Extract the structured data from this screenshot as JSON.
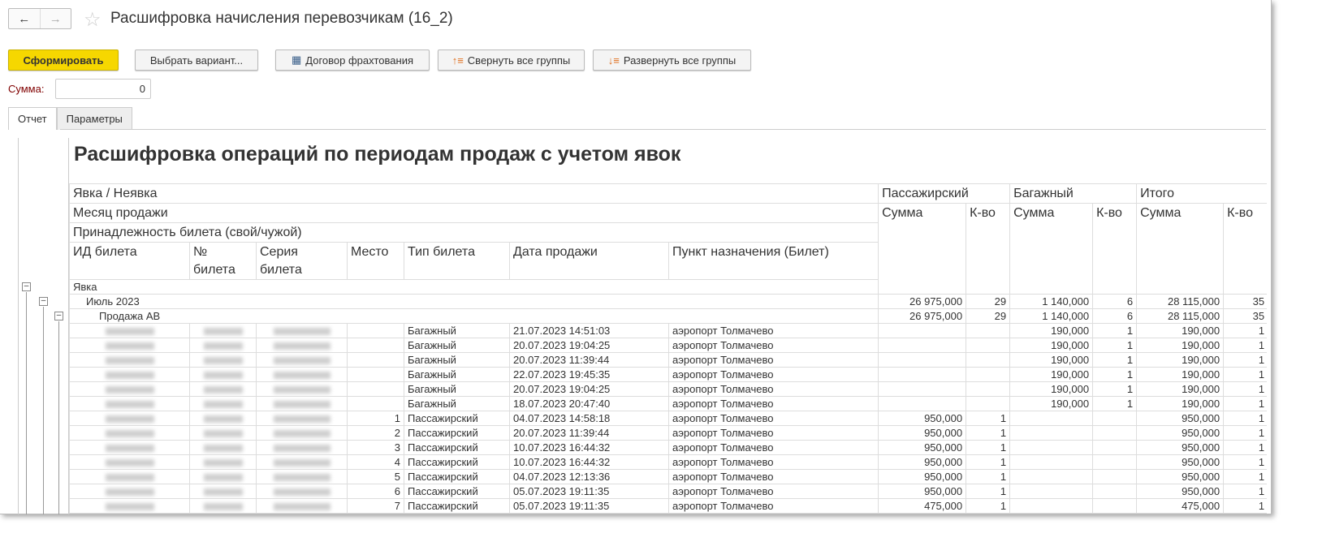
{
  "window": {
    "title": "Расшифровка начисления перевозчикам (16_2)"
  },
  "toolbar": {
    "generate": "Сформировать",
    "choose_variant": "Выбрать вариант...",
    "charter": "Договор фрахтования",
    "collapse": "Свернуть все группы",
    "expand": "Развернуть все группы"
  },
  "sum_field": {
    "label": "Сумма:",
    "value": "0"
  },
  "tabs": [
    "Отчет",
    "Параметры"
  ],
  "report": {
    "title": "Расшифровка операций по периодам продаж с учетом явок",
    "headers": {
      "group1": "Явка / Неявка",
      "group2": "Месяц продажи",
      "group3": "Принадлежность билета (свой/чужой)",
      "cols": [
        "ИД билета",
        "№ билета",
        "Серия билета",
        "Место",
        "Тип билета",
        "Дата продажи",
        "Пункт назначения (Билет)"
      ],
      "passenger": "Пассажирский",
      "baggage": "Багажный",
      "total": "Итого",
      "sum": "Сумма",
      "qty": "К-во"
    },
    "groups": [
      {
        "label": "Явка",
        "p_sum": "26 975,000",
        "p_qty": "29",
        "b_sum": "1 140,000",
        "b_qty": "6",
        "t_sum": "28 115,000",
        "t_qty": "35"
      },
      {
        "label": "Июль 2023",
        "p_sum": "26 975,000",
        "p_qty": "29",
        "b_sum": "1 140,000",
        "b_qty": "6",
        "t_sum": "28 115,000",
        "t_qty": "35"
      },
      {
        "label": "Продажа АВ",
        "p_sum": "26 975,000",
        "p_qty": "29",
        "b_sum": "1 140,000",
        "b_qty": "6",
        "t_sum": "28 115,000",
        "t_qty": "35"
      }
    ],
    "rows": [
      {
        "seat": "",
        "type": "Багажный",
        "date": "21.07.2023 14:51:03",
        "dest": "аэропорт Толмачево",
        "p_sum": "",
        "p_qty": "",
        "b_sum": "190,000",
        "b_qty": "1",
        "t_sum": "190,000",
        "t_qty": "1"
      },
      {
        "seat": "",
        "type": "Багажный",
        "date": "20.07.2023 19:04:25",
        "dest": "аэропорт Толмачево",
        "p_sum": "",
        "p_qty": "",
        "b_sum": "190,000",
        "b_qty": "1",
        "t_sum": "190,000",
        "t_qty": "1"
      },
      {
        "seat": "",
        "type": "Багажный",
        "date": "20.07.2023 11:39:44",
        "dest": "аэропорт Толмачево",
        "p_sum": "",
        "p_qty": "",
        "b_sum": "190,000",
        "b_qty": "1",
        "t_sum": "190,000",
        "t_qty": "1"
      },
      {
        "seat": "",
        "type": "Багажный",
        "date": "22.07.2023 19:45:35",
        "dest": "аэропорт Толмачево",
        "p_sum": "",
        "p_qty": "",
        "b_sum": "190,000",
        "b_qty": "1",
        "t_sum": "190,000",
        "t_qty": "1"
      },
      {
        "seat": "",
        "type": "Багажный",
        "date": "20.07.2023 19:04:25",
        "dest": "аэропорт Толмачево",
        "p_sum": "",
        "p_qty": "",
        "b_sum": "190,000",
        "b_qty": "1",
        "t_sum": "190,000",
        "t_qty": "1"
      },
      {
        "seat": "",
        "type": "Багажный",
        "date": "18.07.2023 20:47:40",
        "dest": "аэропорт Толмачево",
        "p_sum": "",
        "p_qty": "",
        "b_sum": "190,000",
        "b_qty": "1",
        "t_sum": "190,000",
        "t_qty": "1"
      },
      {
        "seat": "1",
        "type": "Пассажирский",
        "date": "04.07.2023 14:58:18",
        "dest": "аэропорт Толмачево",
        "p_sum": "950,000",
        "p_qty": "1",
        "b_sum": "",
        "b_qty": "",
        "t_sum": "950,000",
        "t_qty": "1"
      },
      {
        "seat": "2",
        "type": "Пассажирский",
        "date": "20.07.2023 11:39:44",
        "dest": "аэропорт Толмачево",
        "p_sum": "950,000",
        "p_qty": "1",
        "b_sum": "",
        "b_qty": "",
        "t_sum": "950,000",
        "t_qty": "1"
      },
      {
        "seat": "3",
        "type": "Пассажирский",
        "date": "10.07.2023 16:44:32",
        "dest": "аэропорт Толмачево",
        "p_sum": "950,000",
        "p_qty": "1",
        "b_sum": "",
        "b_qty": "",
        "t_sum": "950,000",
        "t_qty": "1"
      },
      {
        "seat": "4",
        "type": "Пассажирский",
        "date": "10.07.2023 16:44:32",
        "dest": "аэропорт Толмачево",
        "p_sum": "950,000",
        "p_qty": "1",
        "b_sum": "",
        "b_qty": "",
        "t_sum": "950,000",
        "t_qty": "1"
      },
      {
        "seat": "5",
        "type": "Пассажирский",
        "date": "04.07.2023 12:13:36",
        "dest": "аэропорт Толмачево",
        "p_sum": "950,000",
        "p_qty": "1",
        "b_sum": "",
        "b_qty": "",
        "t_sum": "950,000",
        "t_qty": "1"
      },
      {
        "seat": "6",
        "type": "Пассажирский",
        "date": "05.07.2023 19:11:35",
        "dest": "аэропорт Толмачево",
        "p_sum": "950,000",
        "p_qty": "1",
        "b_sum": "",
        "b_qty": "",
        "t_sum": "950,000",
        "t_qty": "1"
      },
      {
        "seat": "7",
        "type": "Пассажирский",
        "date": "05.07.2023 19:11:35",
        "dest": "аэропорт Толмачево",
        "p_sum": "475,000",
        "p_qty": "1",
        "b_sum": "",
        "b_qty": "",
        "t_sum": "475,000",
        "t_qty": "1"
      }
    ]
  },
  "colors": {
    "primary_button": "#f6d700",
    "label": "#800000"
  }
}
